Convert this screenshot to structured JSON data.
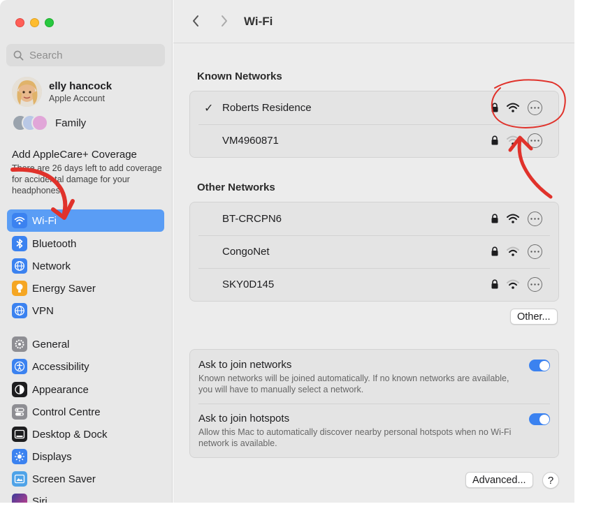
{
  "window": {
    "title": "Wi-Fi"
  },
  "sidebar": {
    "search_placeholder": "Search",
    "account": {
      "name": "elly hancock",
      "subtitle": "Apple Account"
    },
    "family_label": "Family",
    "applecare": {
      "title": "Add AppleCare+ Coverage",
      "body": "There are 26 days left to add coverage for accidental damage for your headphones."
    },
    "items": [
      {
        "label": "Wi-Fi",
        "icon": "wifi-icon",
        "color": "#3b82f0",
        "active": true
      },
      {
        "label": "Bluetooth",
        "icon": "bluetooth-icon",
        "color": "#3b82f0"
      },
      {
        "label": "Network",
        "icon": "globe-icon",
        "color": "#3b82f0"
      },
      {
        "label": "Energy Saver",
        "icon": "lightbulb-icon",
        "color": "#f5a623"
      },
      {
        "label": "VPN",
        "icon": "globe-icon",
        "color": "#3b82f0"
      },
      {
        "label": "General",
        "icon": "gear-icon",
        "color": "#8e8e93"
      },
      {
        "label": "Accessibility",
        "icon": "accessibility-icon",
        "color": "#3b82f0"
      },
      {
        "label": "Appearance",
        "icon": "appearance-icon",
        "color": "#1d1d1f"
      },
      {
        "label": "Control Centre",
        "icon": "control-centre-icon",
        "color": "#8e8e93"
      },
      {
        "label": "Desktop & Dock",
        "icon": "dock-icon",
        "color": "#1d1d1f"
      },
      {
        "label": "Displays",
        "icon": "sun-icon",
        "color": "#3b82f0"
      },
      {
        "label": "Screen Saver",
        "icon": "screen-saver-icon",
        "color": "#4fa3e8"
      },
      {
        "label": "Siri",
        "icon": "siri-icon",
        "color": "#6c4ad8"
      }
    ]
  },
  "known_networks": {
    "heading": "Known Networks",
    "items": [
      {
        "name": "Roberts Residence",
        "connected": true,
        "check": "✓"
      },
      {
        "name": "VM4960871",
        "connected": false
      }
    ]
  },
  "other_networks": {
    "heading": "Other Networks",
    "items": [
      {
        "name": "BT-CRCPN6"
      },
      {
        "name": "CongoNet"
      },
      {
        "name": "SKY0D145"
      }
    ]
  },
  "other_button": "Other...",
  "settings": [
    {
      "title": "Ask to join networks",
      "description": "Known networks will be joined automatically. If no known networks are available, you will have to manually select a network.",
      "on": true
    },
    {
      "title": "Ask to join hotspots",
      "description": "Allow this Mac to automatically discover nearby personal hotspots when no Wi-Fi network is available.",
      "on": true
    }
  ],
  "advanced_button": "Advanced...",
  "help_button": "?",
  "annotation_color": "#e0322b"
}
